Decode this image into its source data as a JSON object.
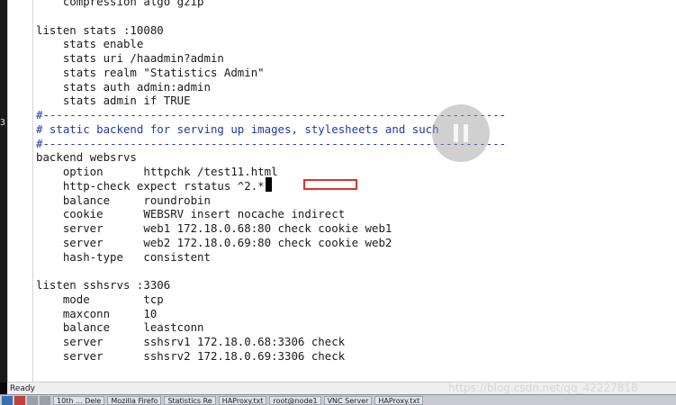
{
  "editor": {
    "left_glyph": "3",
    "lines": [
      {
        "text": "    compression algo gzip",
        "comment": false
      },
      {
        "text": "",
        "comment": false
      },
      {
        "text": "listen stats :10080",
        "comment": false
      },
      {
        "text": "    stats enable",
        "comment": false
      },
      {
        "text": "    stats uri /haadmin?admin",
        "comment": false
      },
      {
        "text": "    stats realm \"Statistics Admin\"",
        "comment": false
      },
      {
        "text": "    stats auth admin:admin",
        "comment": false
      },
      {
        "text": "    stats admin if TRUE",
        "comment": false
      },
      {
        "text": "#---------------------------------------------------------------------",
        "comment": true
      },
      {
        "text": "# static backend for serving up images, stylesheets and such",
        "comment": true
      },
      {
        "text": "#---------------------------------------------------------------------",
        "comment": true
      },
      {
        "text": "backend websrvs",
        "comment": false
      },
      {
        "text": "    option      httpchk /test11.html",
        "comment": false
      },
      {
        "text": "    http-check expect rstatus ^2.*",
        "comment": false
      },
      {
        "text": "    balance     roundrobin",
        "comment": false
      },
      {
        "text": "    cookie      WEBSRV insert nocache indirect",
        "comment": false
      },
      {
        "text": "    server      web1 172.18.0.68:80 check cookie web1",
        "comment": false
      },
      {
        "text": "    server      web2 172.18.0.69:80 check cookie web2",
        "comment": false
      },
      {
        "text": "    hash-type   consistent",
        "comment": false
      },
      {
        "text": "",
        "comment": false
      },
      {
        "text": "listen sshsrvs :3306",
        "comment": false
      },
      {
        "text": "    mode        tcp",
        "comment": false
      },
      {
        "text": "    maxconn     10",
        "comment": false
      },
      {
        "text": "    balance     leastconn",
        "comment": false
      },
      {
        "text": "    server      sshsrv1 172.18.0.68:3306 check",
        "comment": false
      },
      {
        "text": "    server      sshsrv2 172.18.0.69:3306 check",
        "comment": false
      }
    ]
  },
  "status": {
    "text": "Ready"
  },
  "watermark": "https://blog.csdn.net/qq_42227818",
  "taskbar": {
    "items": [
      "10th ... Dele",
      "Mozilla Firefo",
      "Statistics Re",
      "HAProxy.txt",
      "root@node1",
      "VNC Server",
      "HAProxy.txt"
    ]
  },
  "colors": {
    "comment": "#1f3aa6",
    "highlight_box": "#e23030",
    "text": "#1a1a1a"
  }
}
